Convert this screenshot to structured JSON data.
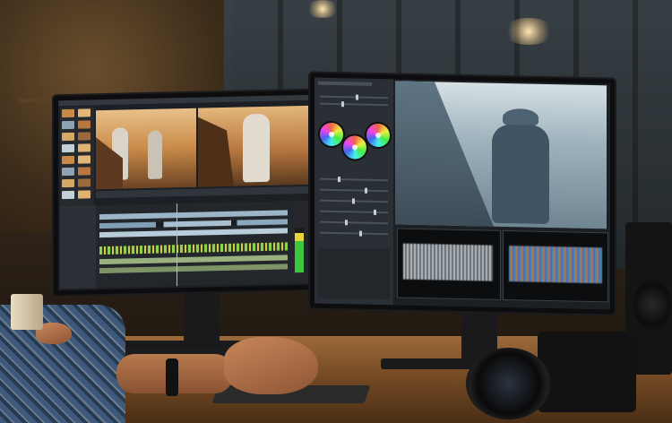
{
  "scene": {
    "colors": {
      "desk": "#9c6a3a",
      "ui_panel": "#2a2f35",
      "accent_timeline": "#8fd14f"
    }
  },
  "left_monitor": {
    "thumbnails": [
      "thumb",
      "thumb",
      "thumb",
      "thumb",
      "thumb",
      "thumb",
      "thumb",
      "thumb",
      "thumb",
      "thumb",
      "thumb",
      "thumb",
      "thumb",
      "thumb",
      "thumb",
      "thumb"
    ]
  },
  "right_monitor": {
    "wheels": [
      "wheel-shadows",
      "wheel-midtones",
      "wheel-highlights"
    ]
  }
}
